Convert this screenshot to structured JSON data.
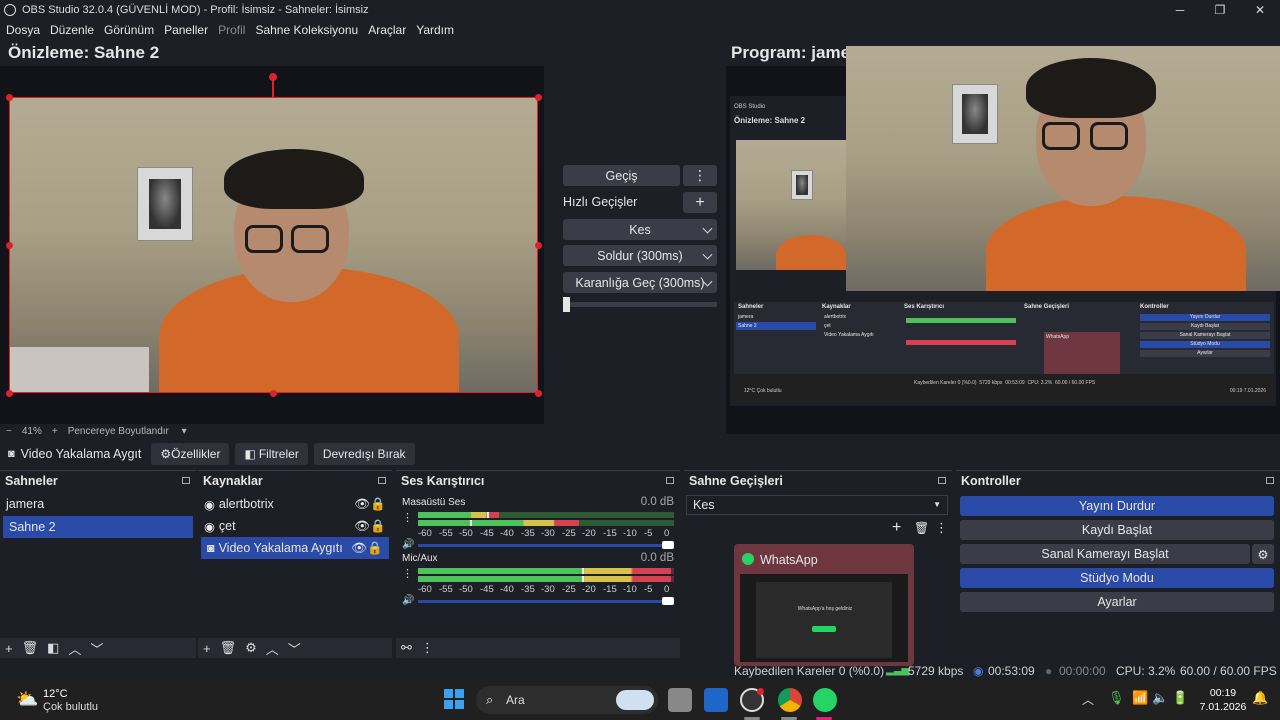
{
  "window": {
    "title": "OBS Studio 32.0.4 (GÜVENLİ MOD) - Profil: İsimsiz - Sahneler: İsimsiz",
    "minimize": "─",
    "maximize": "❐",
    "close": "✕"
  },
  "menu": [
    "Dosya",
    "Düzenle",
    "Görünüm",
    "Paneller",
    "Profil",
    "Sahne Koleksiyonu",
    "Araçlar",
    "Yardım"
  ],
  "preview": {
    "title": "Önizleme: Sahne 2",
    "zoom_minus": "−",
    "zoom_value": "41%",
    "zoom_plus": "+",
    "zoom_mode": "Pencereye Boyutlandır"
  },
  "transition_panel": {
    "transition_button": "Geçiş",
    "quick_transitions_label": "Hızlı Geçişler",
    "quick": [
      "Kes",
      "Soldur (300ms)",
      "Karanlığa Geç (300ms)"
    ]
  },
  "program": {
    "title": "Program: jame"
  },
  "nested_screen": {
    "preview_title": "Önizleme: Sahne 2",
    "docks": [
      "Sahneler",
      "Kaynaklar",
      "Ses Karıştırıcı",
      "Sahne Geçişleri",
      "Kontroller"
    ],
    "scenes": [
      "jamera",
      "Sahne 2"
    ],
    "sources": [
      "alertbotrix",
      "çet",
      "Video Yakalama Aygıtı"
    ],
    "controls": [
      "Yayını Durdur",
      "Kaydı Başlat",
      "Sanal Kamerayı Başlat",
      "Stüdyo Modu",
      "Ayarlar"
    ],
    "weather_temp": "12°C",
    "weather_desc": "Çok bulutlu",
    "popup_title": "WhatsApp",
    "status": [
      "Kaybedilen Kareler 0 (%0.0)",
      "5729 kbps",
      "00:53:09",
      "CPU: 3.2%",
      "60.00 / 60.00 FPS"
    ],
    "clock_time": "00:19",
    "clock_date": "7.01.2026"
  },
  "source_toolbar": {
    "source_name": "Video Yakalama Aygıt",
    "properties": "Özellikler",
    "filters": "Filtreler",
    "deactivate": "Devredışı Bırak"
  },
  "scenes": {
    "header": "Sahneler",
    "items": [
      "jamera",
      "Sahne 2"
    ],
    "selected_index": 1
  },
  "sources": {
    "header": "Kaynaklar",
    "items": [
      "alertbotrix",
      "çet",
      "Video Yakalama Aygıtı"
    ],
    "selected_index": 2
  },
  "mixer": {
    "header": "Ses Karıştırıcı",
    "channels": [
      {
        "name": "Masaüstü Ses",
        "db": "0.0 dB",
        "level_fraction": 0.63,
        "peak_fraction": 0.27
      },
      {
        "name": "Mic/Aux",
        "db": "0.0 dB",
        "level_fraction": 0.99,
        "peak_fraction": 0.64
      }
    ],
    "scale": [
      "-60",
      "-55",
      "-50",
      "-45",
      "-40",
      "-35",
      "-30",
      "-25",
      "-20",
      "-15",
      "-10",
      "-5",
      "0"
    ]
  },
  "scene_transitions": {
    "header": "Sahne Geçişleri",
    "selected": "Kes"
  },
  "controls": {
    "header": "Kontroller",
    "buttons": [
      "Yayını Durdur",
      "Kaydı Başlat",
      "Sanal Kamerayı Başlat",
      "Stüdyo Modu",
      "Ayarlar"
    ]
  },
  "whatsapp_popup": {
    "title": "WhatsApp",
    "welcome": "WhatsApp'a hoş geldiniz"
  },
  "status": {
    "dropped_frames": "Kaybedilen Kareler 0 (%0.0)",
    "bitrate": "5729 kbps",
    "stream_time": "00:53:09",
    "record_time": "00:00:00",
    "cpu": "CPU: 3.2%",
    "fps": "60.00 / 60.00 FPS"
  },
  "taskbar": {
    "temperature": "12°C",
    "weather": "Çok bulutlu",
    "search_placeholder": "Ara",
    "time": "00:19",
    "date": "7.01.2026"
  },
  "colors": {
    "accent": "#2a4aa8",
    "selection_red": "#e0202a",
    "meter_green": "#4ec25a",
    "meter_yellow": "#d7c34a",
    "meter_red": "#d64050"
  }
}
